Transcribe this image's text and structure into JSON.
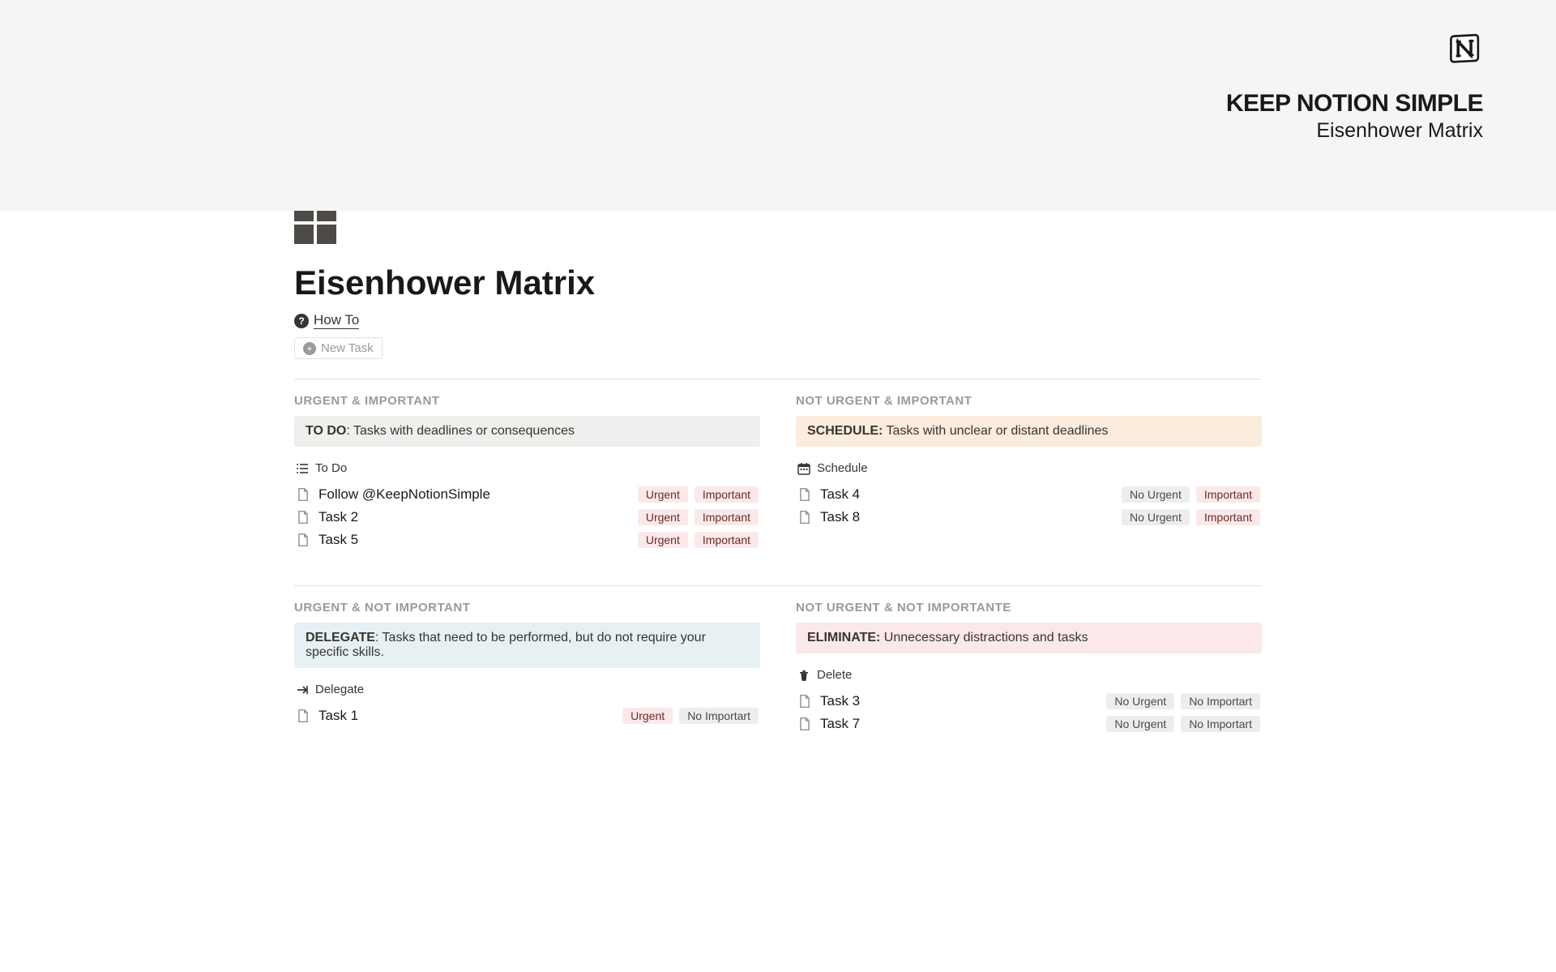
{
  "cover": {
    "title": "KEEP NOTION SIMPLE",
    "subtitle": "Eisenhower Matrix"
  },
  "page": {
    "title": "Eisenhower Matrix",
    "howto_label": "How To",
    "new_task_label": "New Task"
  },
  "tag_labels": {
    "urgent": "Urgent",
    "important": "Important",
    "no_urgent": "No Urgent",
    "no_important": "No Importart"
  },
  "quadrants": {
    "q1": {
      "heading": "URGENT & IMPORTANT",
      "callout_bold": "TO DO",
      "callout_text": ": Tasks with deadlines or consequences",
      "callout_bg": "bg-green",
      "view_icon": "list-icon",
      "view_label": "To Do",
      "tasks": [
        {
          "title": "Follow @KeepNotionSimple",
          "tags": [
            "urgent",
            "important"
          ]
        },
        {
          "title": "Task 2",
          "tags": [
            "urgent",
            "important"
          ]
        },
        {
          "title": "Task 5",
          "tags": [
            "urgent",
            "important"
          ]
        }
      ]
    },
    "q2": {
      "heading": "NOT URGENT & IMPORTANT",
      "callout_bold": "SCHEDULE:",
      "callout_text": " Tasks with unclear or distant deadlines",
      "callout_bg": "bg-orange",
      "view_icon": "calendar-icon",
      "view_label": "Schedule",
      "tasks": [
        {
          "title": "Task 4",
          "tags": [
            "no_urgent",
            "important"
          ]
        },
        {
          "title": "Task 8",
          "tags": [
            "no_urgent",
            "important"
          ]
        }
      ]
    },
    "q3": {
      "heading": "URGENT & NOT IMPORTANT",
      "callout_bold": "DELEGATE",
      "callout_text": ": Tasks that need to be performed, but do not require your specific skills.",
      "callout_bg": "bg-blue",
      "view_icon": "arrow-right-icon",
      "view_label": "Delegate",
      "tasks": [
        {
          "title": "Task 1",
          "tags": [
            "urgent",
            "no_important"
          ]
        }
      ]
    },
    "q4": {
      "heading": "NOT URGENT & NOT IMPORTANTE",
      "callout_bold": "ELIMINATE:",
      "callout_text": " Unnecessary distractions and tasks",
      "callout_bg": "bg-red",
      "view_icon": "trash-icon",
      "view_label": "Delete",
      "tasks": [
        {
          "title": "Task 3",
          "tags": [
            "no_urgent",
            "no_important"
          ]
        },
        {
          "title": "Task 7",
          "tags": [
            "no_urgent",
            "no_important"
          ]
        }
      ]
    }
  }
}
